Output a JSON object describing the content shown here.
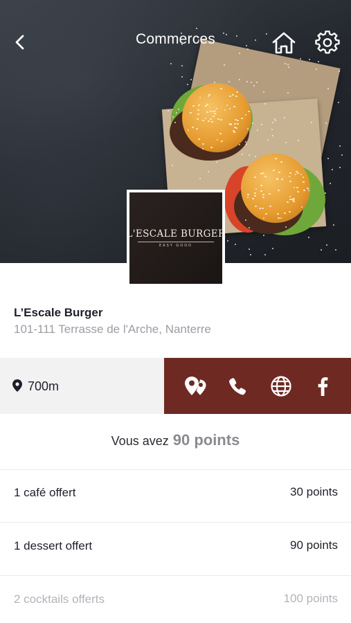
{
  "header": {
    "title": "Commerces",
    "back_icon": "chevron-left-icon",
    "home_icon": "home-icon",
    "settings_icon": "gear-icon"
  },
  "logo": {
    "title": "L'ESCALE BURGER",
    "subtitle": "EASY GOOD"
  },
  "shop": {
    "name": "L’Escale Burger",
    "address": "101-111 Terrasse de l'Arche, Nanterre"
  },
  "distance": {
    "icon": "map-pin-icon",
    "value": "700m"
  },
  "actions": [
    {
      "icon": "directions-icon"
    },
    {
      "icon": "phone-icon"
    },
    {
      "icon": "globe-icon"
    },
    {
      "icon": "facebook-icon"
    }
  ],
  "points": {
    "prefix": "Vous avez",
    "value": "90 points"
  },
  "rewards": [
    {
      "label": "1 café offert",
      "points": "30 points",
      "available": true
    },
    {
      "label": "1 dessert offert",
      "points": "90 points",
      "available": true
    },
    {
      "label": "2 cocktails offerts",
      "points": "100 points",
      "available": false
    }
  ],
  "colors": {
    "accent": "#6e2a22",
    "distance_bg": "#f2f2f3",
    "text_dark": "#1f1f2a",
    "text_muted": "#9b9da4",
    "points_value": "#8a8b90"
  }
}
